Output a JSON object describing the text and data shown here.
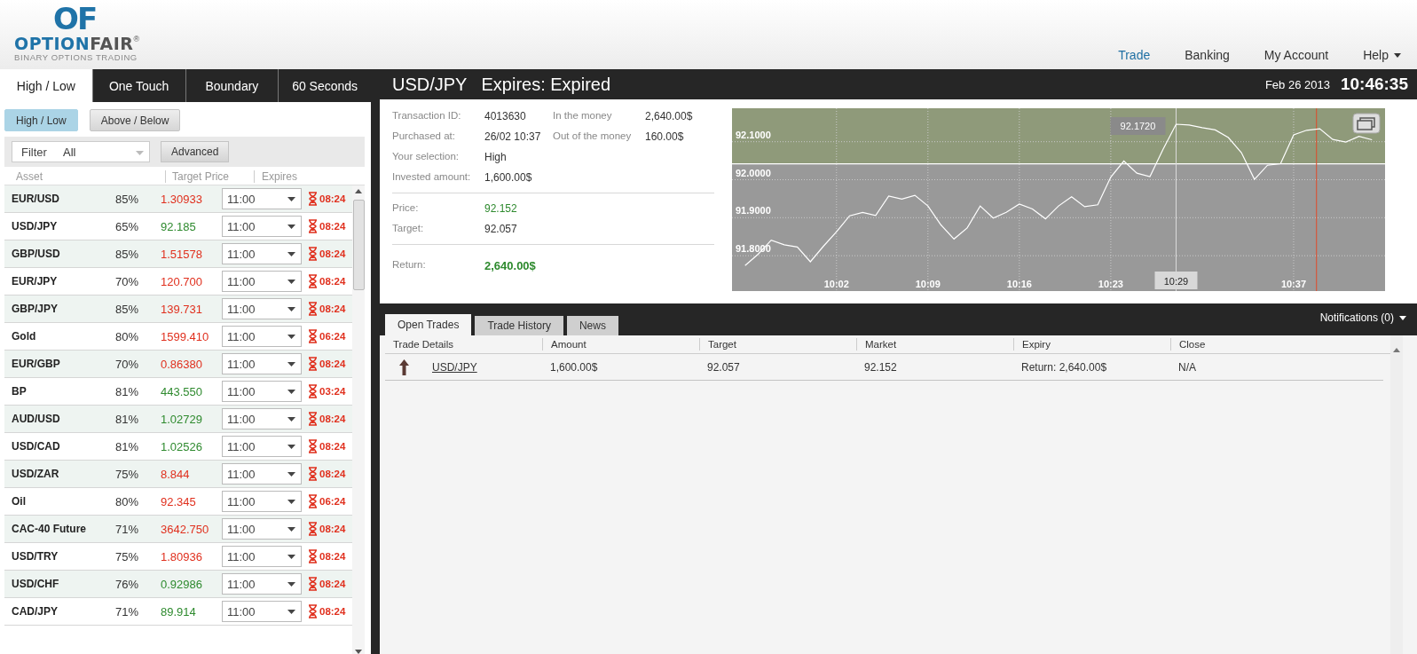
{
  "header": {
    "logo": {
      "mark": "OF",
      "name_first": "OPTION",
      "name_second": "FAIR",
      "registered": "®",
      "tagline": "BINARY OPTIONS TRADING"
    },
    "nav": [
      {
        "label": "Trade",
        "selected": true,
        "dropdown": false
      },
      {
        "label": "Banking",
        "selected": false,
        "dropdown": false
      },
      {
        "label": "My Account",
        "selected": false,
        "dropdown": false
      },
      {
        "label": "Help",
        "selected": false,
        "dropdown": true
      }
    ]
  },
  "left_panel": {
    "tabs": [
      {
        "label": "High / Low",
        "selected": true
      },
      {
        "label": "One Touch",
        "selected": false
      },
      {
        "label": "Boundary",
        "selected": false
      },
      {
        "label": "60 Seconds",
        "selected": false
      }
    ],
    "subtabs": [
      {
        "label": "High / Low",
        "selected": true
      },
      {
        "label": "Above / Below",
        "selected": false
      }
    ],
    "filter": {
      "label": "Filter",
      "value": "All"
    },
    "advanced_button": "Advanced",
    "columns": [
      "Asset",
      "Target Price",
      "Expires"
    ],
    "rows": [
      {
        "asset": "EUR/USD",
        "payout": "85%",
        "price": "1.30933",
        "color": "#e0301e",
        "expiry": "11:00",
        "countdown": "08:24"
      },
      {
        "asset": "USD/JPY",
        "payout": "65%",
        "price": "92.185",
        "color": "#2e8a2e",
        "expiry": "11:00",
        "countdown": "08:24"
      },
      {
        "asset": "GBP/USD",
        "payout": "85%",
        "price": "1.51578",
        "color": "#e0301e",
        "expiry": "11:00",
        "countdown": "08:24"
      },
      {
        "asset": "EUR/JPY",
        "payout": "70%",
        "price": "120.700",
        "color": "#e0301e",
        "expiry": "11:00",
        "countdown": "08:24"
      },
      {
        "asset": "GBP/JPY",
        "payout": "85%",
        "price": "139.731",
        "color": "#e0301e",
        "expiry": "11:00",
        "countdown": "08:24"
      },
      {
        "asset": "Gold",
        "payout": "80%",
        "price": "1599.410",
        "color": "#e0301e",
        "expiry": "11:00",
        "countdown": "06:24"
      },
      {
        "asset": "EUR/GBP",
        "payout": "70%",
        "price": "0.86380",
        "color": "#e0301e",
        "expiry": "11:00",
        "countdown": "08:24"
      },
      {
        "asset": "BP",
        "payout": "81%",
        "price": "443.550",
        "color": "#2e8a2e",
        "expiry": "11:00",
        "countdown": "03:24"
      },
      {
        "asset": "AUD/USD",
        "payout": "81%",
        "price": "1.02729",
        "color": "#2e8a2e",
        "expiry": "11:00",
        "countdown": "08:24"
      },
      {
        "asset": "USD/CAD",
        "payout": "81%",
        "price": "1.02526",
        "color": "#2e8a2e",
        "expiry": "11:00",
        "countdown": "08:24"
      },
      {
        "asset": "USD/ZAR",
        "payout": "75%",
        "price": "8.844",
        "color": "#e0301e",
        "expiry": "11:00",
        "countdown": "08:24"
      },
      {
        "asset": "Oil",
        "payout": "80%",
        "price": "92.345",
        "color": "#e0301e",
        "expiry": "11:00",
        "countdown": "06:24"
      },
      {
        "asset": "CAC-40 Future",
        "payout": "71%",
        "price": "3642.750",
        "color": "#e0301e",
        "expiry": "11:00",
        "countdown": "08:24"
      },
      {
        "asset": "USD/TRY",
        "payout": "75%",
        "price": "1.80936",
        "color": "#e0301e",
        "expiry": "11:00",
        "countdown": "08:24"
      },
      {
        "asset": "USD/CHF",
        "payout": "76%",
        "price": "0.92986",
        "color": "#2e8a2e",
        "expiry": "11:00",
        "countdown": "08:24"
      },
      {
        "asset": "CAD/JPY",
        "payout": "71%",
        "price": "89.914",
        "color": "#2e8a2e",
        "expiry": "11:00",
        "countdown": "08:24"
      }
    ]
  },
  "trade_panel": {
    "asset": "USD/JPY",
    "status": "Expires: Expired",
    "date": "Feb 26 2013",
    "time": "10:46:35",
    "details": [
      {
        "label": "Transaction ID:",
        "value": "4013630",
        "side_label": "In the money",
        "side_value": "2,640.00$"
      },
      {
        "label": "Purchased at:",
        "value": "26/02 10:37",
        "side_label": "Out of the money",
        "side_value": "160.00$"
      },
      {
        "label": "Your selection:",
        "value": "High"
      },
      {
        "label": "Invested amount:",
        "value": "1,600.00$"
      }
    ],
    "prices": [
      {
        "label": "Price:",
        "value": "92.152",
        "kind": "gain"
      },
      {
        "label": "Target:",
        "value": "92.057",
        "kind": "plain"
      }
    ],
    "return": {
      "label": "Return:",
      "value": "2,640.00$"
    },
    "chart_data": {
      "type": "line",
      "categories": [
        null,
        null,
        null,
        null,
        null,
        null,
        null,
        "10:02",
        null,
        null,
        null,
        null,
        null,
        null,
        "10:09",
        null,
        null,
        null,
        null,
        null,
        null,
        "10:16",
        null,
        null,
        null,
        null,
        null,
        null,
        "10:23",
        null,
        null,
        null,
        null,
        null,
        null,
        null,
        null,
        null,
        null,
        null,
        null,
        null,
        "10:37",
        null,
        null,
        null,
        null,
        null,
        null
      ],
      "series": [
        {
          "color": "#ffffff",
          "values": [
            91.774,
            91.804,
            91.841,
            91.829,
            91.823,
            91.784,
            91.825,
            91.863,
            91.905,
            91.914,
            91.906,
            91.957,
            91.949,
            91.959,
            91.931,
            91.881,
            91.844,
            91.873,
            91.931,
            91.899,
            91.914,
            91.936,
            91.923,
            91.897,
            91.931,
            91.955,
            91.929,
            91.934,
            92.007,
            92.049,
            92.017,
            92.008,
            92.08,
            92.146,
            92.144,
            92.137,
            92.131,
            92.111,
            92.071,
            92.001,
            92.038,
            92.042,
            92.118,
            92.13,
            92.134,
            92.106,
            92.099,
            92.114,
            92.105
          ]
        }
      ],
      "ylim": [
        91.707,
        92.188
      ],
      "yticks": [
        {
          "value": 91.8,
          "label": "91.8000"
        },
        {
          "value": 91.9,
          "label": "91.9000"
        },
        {
          "value": 92.0,
          "label": "92.0000"
        },
        {
          "value": 92.1,
          "label": "92.1000"
        }
      ],
      "grid": true,
      "annotations": [
        {
          "text": "92.1720"
        },
        {
          "text": "10:29"
        }
      ],
      "ref_lines": [
        {
          "axis": "y",
          "value": 92.042
        }
      ],
      "bands": [
        {
          "axis": "y",
          "from": 92.042,
          "to": 92.188,
          "color": "#8f9a7a"
        }
      ]
    }
  },
  "trades": {
    "tabs": [
      {
        "label": "Open Trades",
        "selected": true
      },
      {
        "label": "Trade History",
        "selected": false
      },
      {
        "label": "News",
        "selected": false
      }
    ],
    "notifications": "Notifications (0)",
    "columns": [
      "Trade Details",
      "Amount",
      "Target",
      "Market",
      "Expiry",
      "Close"
    ],
    "rows": [
      {
        "asset": "USD/JPY",
        "amount": "1,600.00$",
        "target": "92.057",
        "market": "92.152",
        "expiry": "Return: 2,640.00$",
        "close": "N/A"
      }
    ]
  }
}
